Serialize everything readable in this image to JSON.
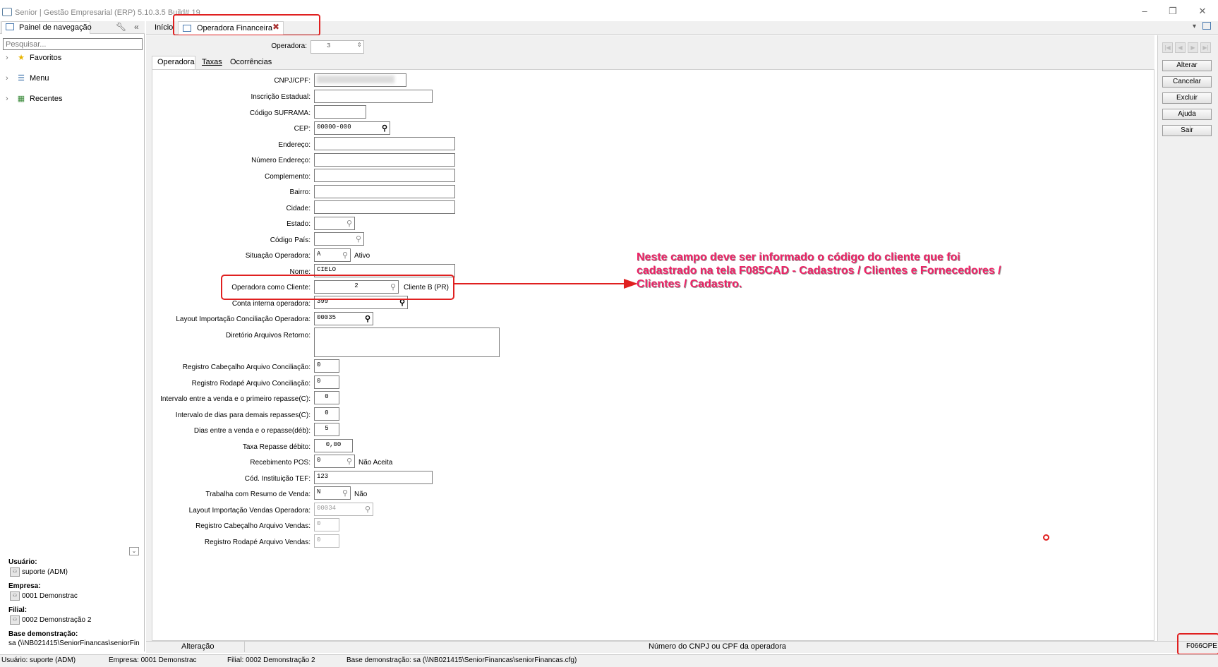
{
  "app": {
    "title": "Senior | Gestão Empresarial (ERP) 5.10.3.5 Build# 19"
  },
  "nav": {
    "tab_label": "Painel de navegação",
    "search_placeholder": "Pesquisar...",
    "items": [
      {
        "label": "Favoritos",
        "icon": "star-icon"
      },
      {
        "label": "Menu",
        "icon": "menu-icon"
      },
      {
        "label": "Recentes",
        "icon": "calendar-icon"
      }
    ],
    "user_label": "Usuário:",
    "user_value": "suporte (ADM)",
    "empresa_label": "Empresa:",
    "empresa_value": "0001 Demonstrac",
    "filial_label": "Filial:",
    "filial_value": "0002 Demonstração 2",
    "base_label": "Base demonstração:",
    "base_value": "sa (\\\\NB021415\\SeniorFinancas\\seniorFin"
  },
  "tabs": {
    "home": "Início",
    "current": "Operadora Financeira"
  },
  "header": {
    "operadora_label": "Operadora:",
    "operadora_value": "3"
  },
  "subtabs": [
    "Operadora",
    "Taxas",
    "Ocorrências"
  ],
  "form": {
    "cnpj_label": "CNPJ/CPF:",
    "ie_label": "Inscrição Estadual:",
    "suframa_label": "Código SUFRAMA:",
    "cep_label": "CEP:",
    "cep_value": "00000-000",
    "endereco_label": "Endereço:",
    "numero_label": "Número Endereço:",
    "complemento_label": "Complemento:",
    "bairro_label": "Bairro:",
    "cidade_label": "Cidade:",
    "estado_label": "Estado:",
    "pais_label": "Código País:",
    "situacao_label": "Situação Operadora:",
    "situacao_value": "A",
    "situacao_desc": "Ativo",
    "nome_label": "Nome:",
    "nome_value": "CIELO",
    "cliente_label": "Operadora como Cliente:",
    "cliente_value": "2",
    "cliente_desc": "Cliente B (PR)",
    "conta_label": "Conta interna operadora:",
    "conta_value": "399",
    "layout_conc_label": "Layout Importação Conciliação Operadora:",
    "layout_conc_value": "00035",
    "diretorio_label": "Diretório Arquivos Retorno:",
    "reg_cab_conc_label": "Registro Cabeçalho Arquivo Conciliação:",
    "reg_cab_conc_value": "0",
    "reg_rod_conc_label": "Registro Rodapé Arquivo Conciliação:",
    "reg_rod_conc_value": "0",
    "intervalo1_label": "Intervalo entre a venda e o primeiro repasse(C):",
    "intervalo1_value": "0",
    "intervalo2_label": "Intervalo de dias para demais repasses(C):",
    "intervalo2_value": "0",
    "dias_label": "Dias entre a venda e o repasse(déb):",
    "dias_value": "5",
    "taxa_label": "Taxa Repasse débito:",
    "taxa_value": "0,00",
    "pos_label": "Recebimento POS:",
    "pos_value": "0",
    "pos_desc": "Não Aceita",
    "tef_label": "Cód. Instituição TEF:",
    "tef_value": "123",
    "resumo_label": "Trabalha com Resumo de Venda:",
    "resumo_value": "N",
    "resumo_desc": "Não",
    "layout_vendas_label": "Layout Importação Vendas Operadora:",
    "layout_vendas_value": "00034",
    "reg_cab_vendas_label": "Registro Cabeçalho Arquivo Vendas:",
    "reg_cab_vendas_value": "0",
    "reg_rod_vendas_label": "Registro Rodapé Arquivo Vendas:",
    "reg_rod_vendas_value": "0"
  },
  "actions": {
    "alterar": "Alterar",
    "cancelar": "Cancelar",
    "excluir": "Excluir",
    "ajuda": "Ajuda",
    "sair": "Sair"
  },
  "status": {
    "mode": "Alteração",
    "hint": "Número do CNPJ ou CPF da operadora",
    "code": "F066OPE"
  },
  "footer": {
    "usuario": "Usuário: suporte (ADM)",
    "empresa": "Empresa: 0001 Demonstrac",
    "filial": "Filial: 0002 Demonstração 2",
    "base": "Base demonstração: sa (\\\\NB021415\\SeniorFinancas\\seniorFinancas.cfg)"
  },
  "annotation": {
    "text": "Neste campo deve ser informado o código do cliente que foi cadastrado na tela F085CAD - Cadastros / Clientes e Fornecedores / Clientes / Cadastro.",
    "color": "#ee2266"
  }
}
